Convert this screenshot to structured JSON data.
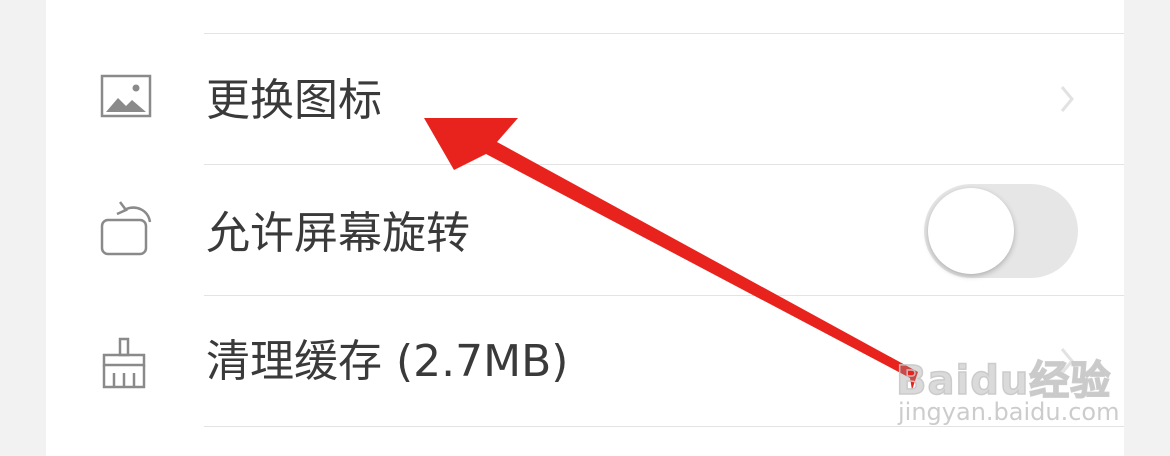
{
  "settings": {
    "items": [
      {
        "label": "更换图标",
        "icon": "image-icon",
        "control": "chevron"
      },
      {
        "label": "允许屏幕旋转",
        "icon": "screen-rotation-icon",
        "control": "toggle",
        "toggle_on": false
      },
      {
        "label": "清理缓存 (2.7MB)",
        "icon": "broom-icon",
        "control": "chevron"
      }
    ]
  },
  "annotation": {
    "arrow_color": "#e8231e"
  },
  "watermark": {
    "main": "Baidu经验",
    "sub": "jingyan.baidu.com"
  }
}
